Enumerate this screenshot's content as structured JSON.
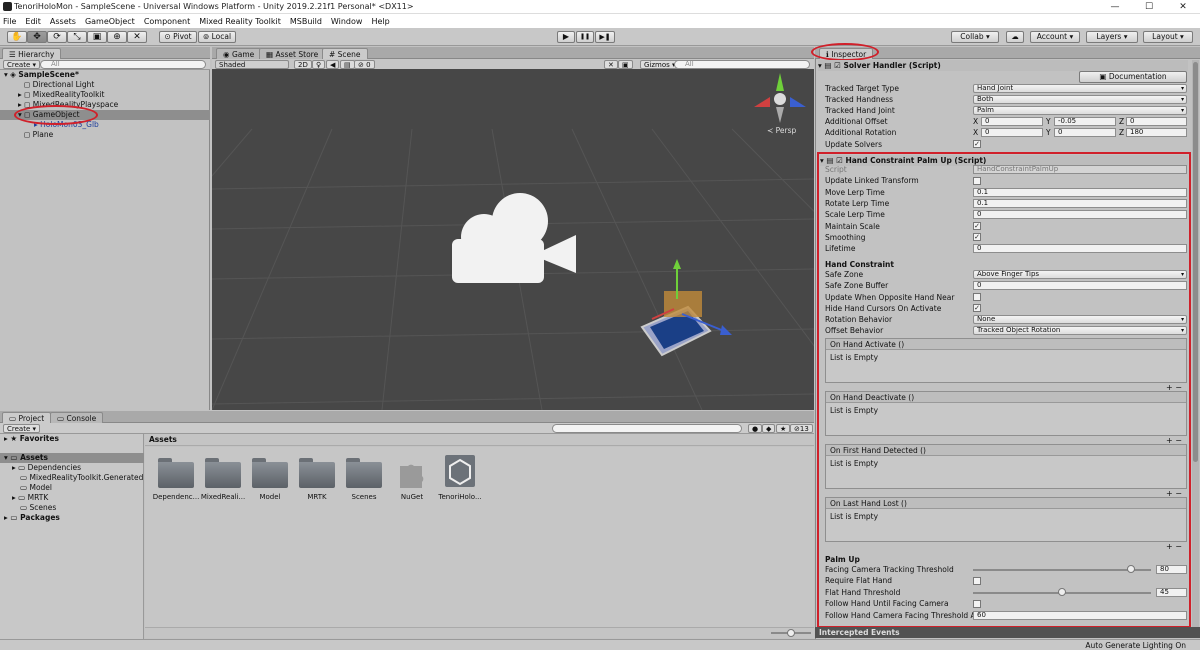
{
  "window": {
    "title": "TenoriHoloMon - SampleScene - Universal Windows Platform - Unity 2019.2.21f1 Personal* <DX11>",
    "controls": [
      "—",
      "☐",
      "✕"
    ]
  },
  "menu": [
    "File",
    "Edit",
    "Assets",
    "GameObject",
    "Component",
    "Mixed Reality Toolkit",
    "MSBuild",
    "Window",
    "Help"
  ],
  "toolbar": {
    "pivot": "Pivot",
    "local": "Local",
    "collab": "Collab ▾",
    "account": "Account",
    "layers": "Layers",
    "layout": "Layout",
    "play_symbols": [
      "▶",
      "❚❚",
      "▶❚"
    ]
  },
  "hierarchy": {
    "tab": "Hierarchy",
    "create": "Create",
    "search_placeholder": "All",
    "scene": "SampleScene*",
    "items": [
      "Directional Light",
      "MixedRealityToolkit",
      "MixedRealityPlayspace",
      "GameObject",
      "HoloMon03_Glb",
      "Plane"
    ]
  },
  "center_tabs": [
    "Game",
    "Asset Store",
    "Scene"
  ],
  "scene_bar": {
    "shading": "Shaded",
    "mode": "2D",
    "gizmos": "Gizmos",
    "search_placeholder": "All",
    "persp": "≺ Persp",
    "counter": "0"
  },
  "project": {
    "tabs": [
      "Project",
      "Console"
    ],
    "create": "Create",
    "counter": "13",
    "tree": [
      {
        "label": "Favorites",
        "bold": true
      },
      {
        "label": "Assets",
        "bold": true
      },
      {
        "label": "Dependencies",
        "bold": false
      },
      {
        "label": "MixedRealityToolkit.Generated",
        "bold": false
      },
      {
        "label": "Model",
        "bold": false
      },
      {
        "label": "MRTK",
        "bold": false
      },
      {
        "label": "Scenes",
        "bold": false
      },
      {
        "label": "Packages",
        "bold": true
      }
    ],
    "breadcrumb": "Assets",
    "assets": [
      "Dependenc...",
      "MixedReali...",
      "Model",
      "MRTK",
      "Scenes",
      "NuGet",
      "TenoriHolo..."
    ]
  },
  "inspector": {
    "tab": "Inspector",
    "solver": {
      "header": "Solver Handler (Script)",
      "documentation": "Documentation",
      "tracked_target_type_label": "Tracked Target Type",
      "tracked_target_type": "Hand Joint",
      "tracked_handness_label": "Tracked Handness",
      "tracked_handness": "Both",
      "tracked_hand_joint_label": "Tracked Hand Joint",
      "tracked_hand_joint": "Palm",
      "offset_label": "Additional Offset",
      "offset": {
        "x": "0",
        "y": "-0.05",
        "z": "0"
      },
      "rotation_label": "Additional Rotation",
      "rotation": {
        "x": "0",
        "y": "0",
        "z": "180"
      },
      "update_solvers_label": "Update Solvers"
    },
    "palm": {
      "header": "Hand Constraint Palm Up (Script)",
      "script_label": "Script",
      "script_value": "HandConstraintPalmUp",
      "update_linked_label": "Update Linked Transform",
      "move_lerp_label": "Move Lerp Time",
      "move_lerp": "0.1",
      "rotate_lerp_label": "Rotate Lerp Time",
      "rotate_lerp": "0.1",
      "scale_lerp_label": "Scale Lerp Time",
      "scale_lerp": "0",
      "maintain_scale_label": "Maintain Scale",
      "smoothing_label": "Smoothing",
      "lifetime_label": "Lifetime",
      "lifetime": "0",
      "hand_constraint_title": "Hand Constraint",
      "safe_zone_label": "Safe Zone",
      "safe_zone": "Above Finger Tips",
      "safe_zone_buffer_label": "Safe Zone Buffer",
      "safe_zone_buffer": "0",
      "update_opposite_label": "Update When Opposite Hand Near",
      "hide_cursors_label": "Hide Hand Cursors On Activate",
      "rotation_behavior_label": "Rotation Behavior",
      "rotation_behavior": "None",
      "offset_behavior_label": "Offset Behavior",
      "offset_behavior": "Tracked Object Rotation",
      "events": [
        {
          "title": "On Hand Activate ()",
          "body": "List is Empty"
        },
        {
          "title": "On Hand Deactivate ()",
          "body": "List is Empty"
        },
        {
          "title": "On First Hand Detected ()",
          "body": "List is Empty"
        },
        {
          "title": "On Last Hand Lost ()",
          "body": "List is Empty"
        }
      ],
      "event_footer": "+ −",
      "palm_up_title": "Palm Up",
      "facing_threshold_label": "Facing Camera Tracking Threshold",
      "facing_threshold": 80,
      "require_flat_label": "Require Flat Hand",
      "flat_threshold_label": "Flat Hand Threshold",
      "flat_threshold": 45,
      "follow_until_label": "Follow Hand Until Facing Camera",
      "follow_threshold_label": "Follow Hand Camera Facing Threshold An",
      "follow_threshold": "60"
    },
    "intercepted": "Intercepted Events"
  },
  "statusbar": "Auto Generate Lighting On",
  "colors": {
    "annotation_red": "#d0202a",
    "scene_bg": "#474747"
  }
}
